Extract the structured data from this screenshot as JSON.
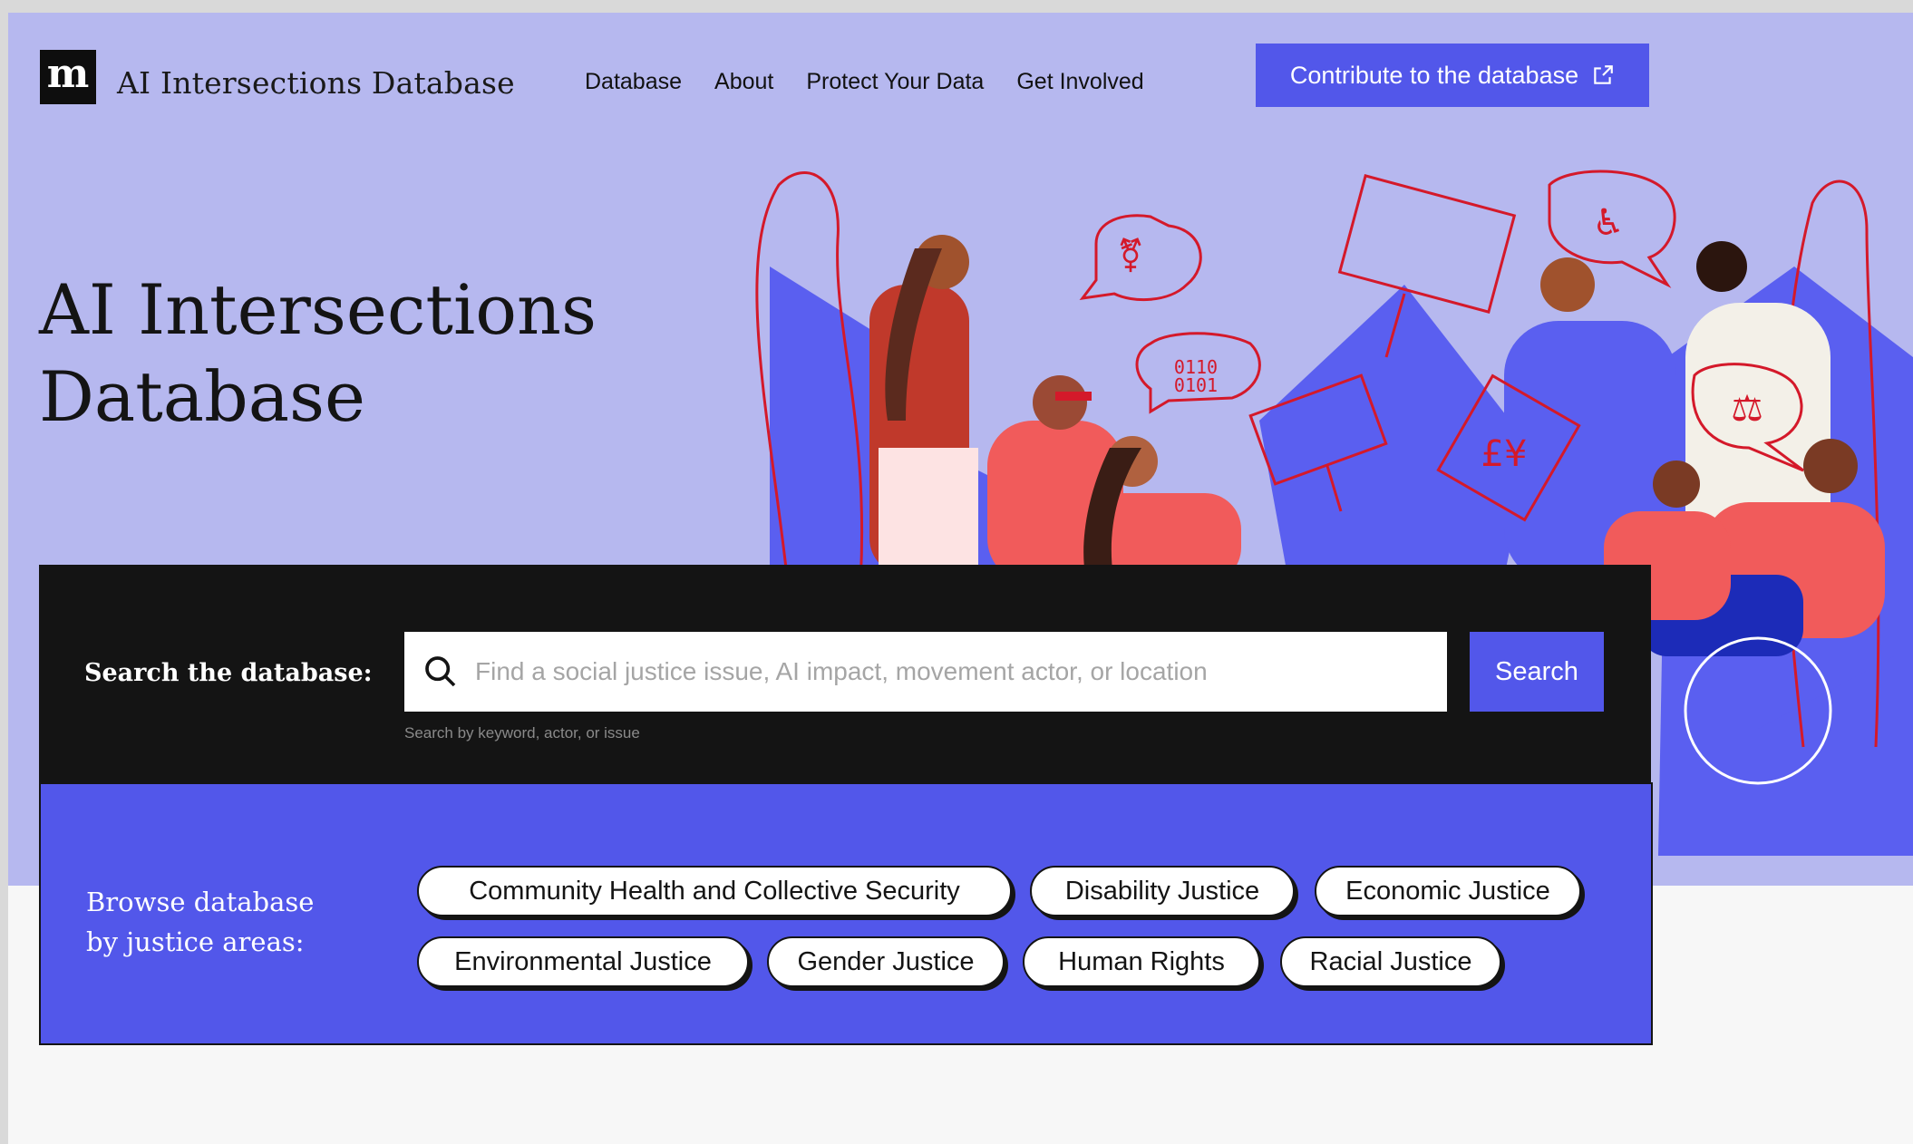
{
  "brand": {
    "logo_letter": "m",
    "name": "AI Intersections Database"
  },
  "nav": {
    "items": [
      "Database",
      "About",
      "Protect Your Data",
      "Get Involved"
    ],
    "contribute_label": "Contribute to the database"
  },
  "hero": {
    "title_line1": "AI Intersections",
    "title_line2": "Database"
  },
  "search": {
    "label": "Search the database:",
    "placeholder": "Find a social justice issue, AI impact, movement actor, or location",
    "button_label": "Search",
    "hint": "Search by keyword, actor, or issue"
  },
  "browse": {
    "label_line1": "Browse database",
    "label_line2": "by justice areas:",
    "areas": [
      "Community Health and Collective Security",
      "Disability Justice",
      "Economic Justice",
      "Environmental Justice",
      "Gender Justice",
      "Human Rights",
      "Racial Justice"
    ]
  },
  "illustration": {
    "icons": [
      "gender-symbol-sign",
      "binary-code-bubble",
      "protest-sign-figures",
      "currency-sign",
      "wheelchair-bubble",
      "scales-bubble",
      "hand-shovel-sign"
    ]
  },
  "colors": {
    "accent": "#5257ea",
    "hero_bg": "#b6b8ef",
    "dark": "#141414",
    "illustration_red": "#d4192a",
    "coral": "#f15b5b"
  }
}
